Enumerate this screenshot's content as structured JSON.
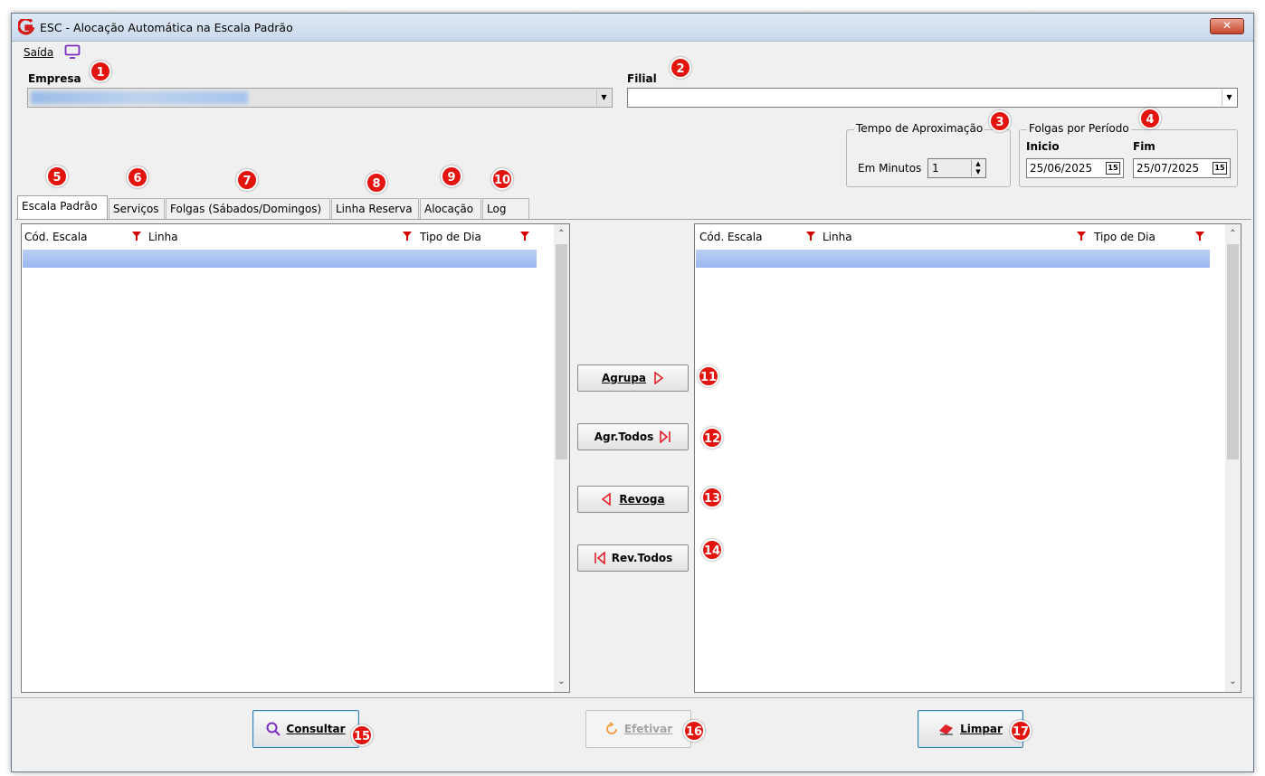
{
  "window": {
    "title": "ESC - Alocação Automática na Escala Padrão",
    "close_label": "✕"
  },
  "menu": {
    "exit_label": "Saída"
  },
  "filters": {
    "empresa_label": "Empresa",
    "filial_label": "Filial",
    "filial_value": ""
  },
  "approximation": {
    "group_label": "Tempo de Aproximação",
    "minutes_label": "Em Minutos",
    "minutes_value": "1"
  },
  "folgas": {
    "group_label": "Folgas por Período",
    "start_label": "Inicio",
    "end_label": "Fim",
    "start_value": "25/06/2025",
    "end_value": "25/07/2025"
  },
  "tabs": [
    {
      "label": "Escala Padrão",
      "active": true
    },
    {
      "label": "Serviços"
    },
    {
      "label": "Folgas (Sábados/Domingos)"
    },
    {
      "label": "Linha Reserva"
    },
    {
      "label": "Alocação"
    },
    {
      "label": "Log"
    }
  ],
  "left_grid": {
    "columns": [
      "Cód. Escala",
      "Linha",
      "Tipo de Dia"
    ]
  },
  "right_grid": {
    "columns": [
      "Cód. Escala",
      "Linha",
      "Tipo de Dia"
    ]
  },
  "transfer_buttons": {
    "agrupa": "Agrupa",
    "agr_todos": "Agr.Todos",
    "revoga": "Revoga",
    "rev_todos": "Rev.Todos"
  },
  "footer_buttons": {
    "consultar": "Consultar",
    "efetivar": "Efetivar",
    "limpar": "Limpar"
  },
  "badges": [
    "1",
    "2",
    "3",
    "4",
    "5",
    "6",
    "7",
    "8",
    "9",
    "10",
    "11",
    "12",
    "13",
    "14",
    "15",
    "16",
    "17"
  ],
  "colors": {
    "badge": "#e3140e",
    "selection": "#9ab8ef",
    "filter_icon": "#d40000",
    "accent_purple": "#7b2fbf"
  }
}
